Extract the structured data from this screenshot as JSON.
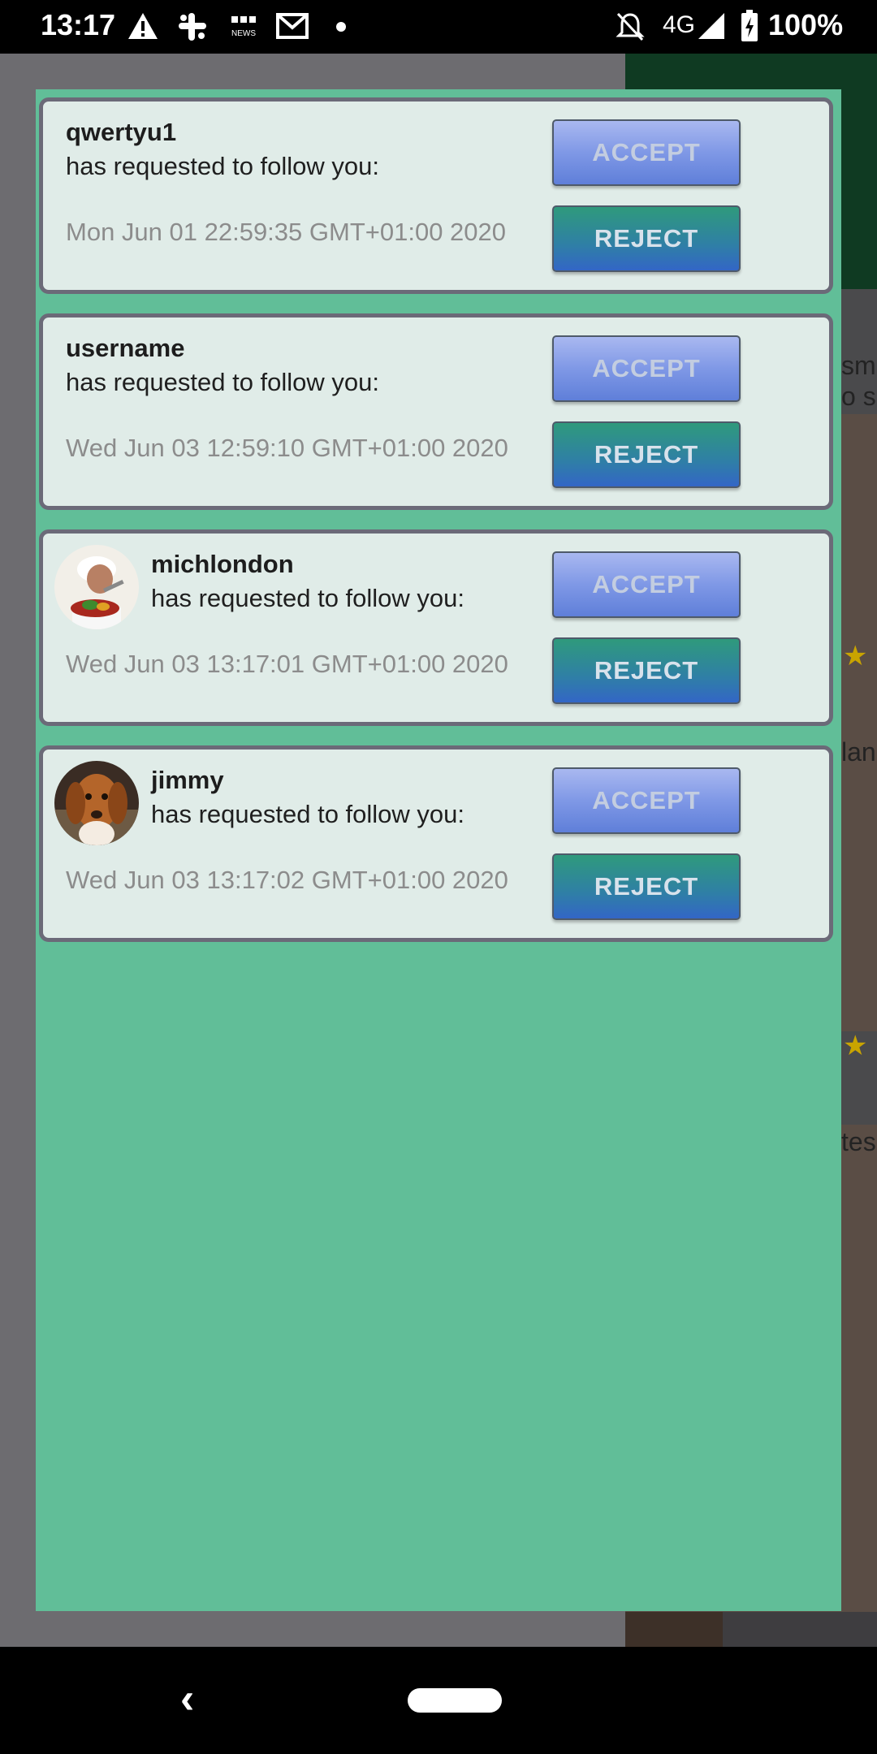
{
  "status_bar": {
    "time": "13:17",
    "network": "4G",
    "battery": "100%",
    "icons": [
      "warning-icon",
      "slack-icon",
      "bbc-news-icon",
      "gmail-icon",
      "dot-icon",
      "notifications-off-icon",
      "signal-icon",
      "battery-charging-icon"
    ]
  },
  "background": {
    "snippets": [
      "sm",
      "o s",
      "lan",
      "tes"
    ]
  },
  "requests": [
    {
      "username": "qwertyu1",
      "message": "has requested to follow you:",
      "date": "Mon Jun 01 22:59:35 GMT+01:00 2020",
      "accept_label": "ACCEPT",
      "reject_label": "REJECT",
      "has_avatar": false
    },
    {
      "username": "username",
      "message": "has requested to follow you:",
      "date": "Wed Jun 03 12:59:10 GMT+01:00 2020",
      "accept_label": "ACCEPT",
      "reject_label": "REJECT",
      "has_avatar": false
    },
    {
      "username": "michlondon",
      "message": "has requested to follow you:",
      "date": "Wed Jun 03 13:17:01 GMT+01:00 2020",
      "accept_label": "ACCEPT",
      "reject_label": "REJECT",
      "has_avatar": true,
      "avatar_icon": "chef-avatar"
    },
    {
      "username": "jimmy",
      "message": "has requested to follow you:",
      "date": "Wed Jun 03 13:17:02 GMT+01:00 2020",
      "accept_label": "ACCEPT",
      "reject_label": "REJECT",
      "has_avatar": true,
      "avatar_icon": "dog-avatar"
    }
  ],
  "nav_bar": {
    "back_icon": "back-icon",
    "home_icon": "home-pill-icon"
  },
  "colors": {
    "dialog_background": "#61be98",
    "card_background": "#e0ece8",
    "accept_button": "#7f98e6",
    "reject_button": "#2f7fa6"
  }
}
